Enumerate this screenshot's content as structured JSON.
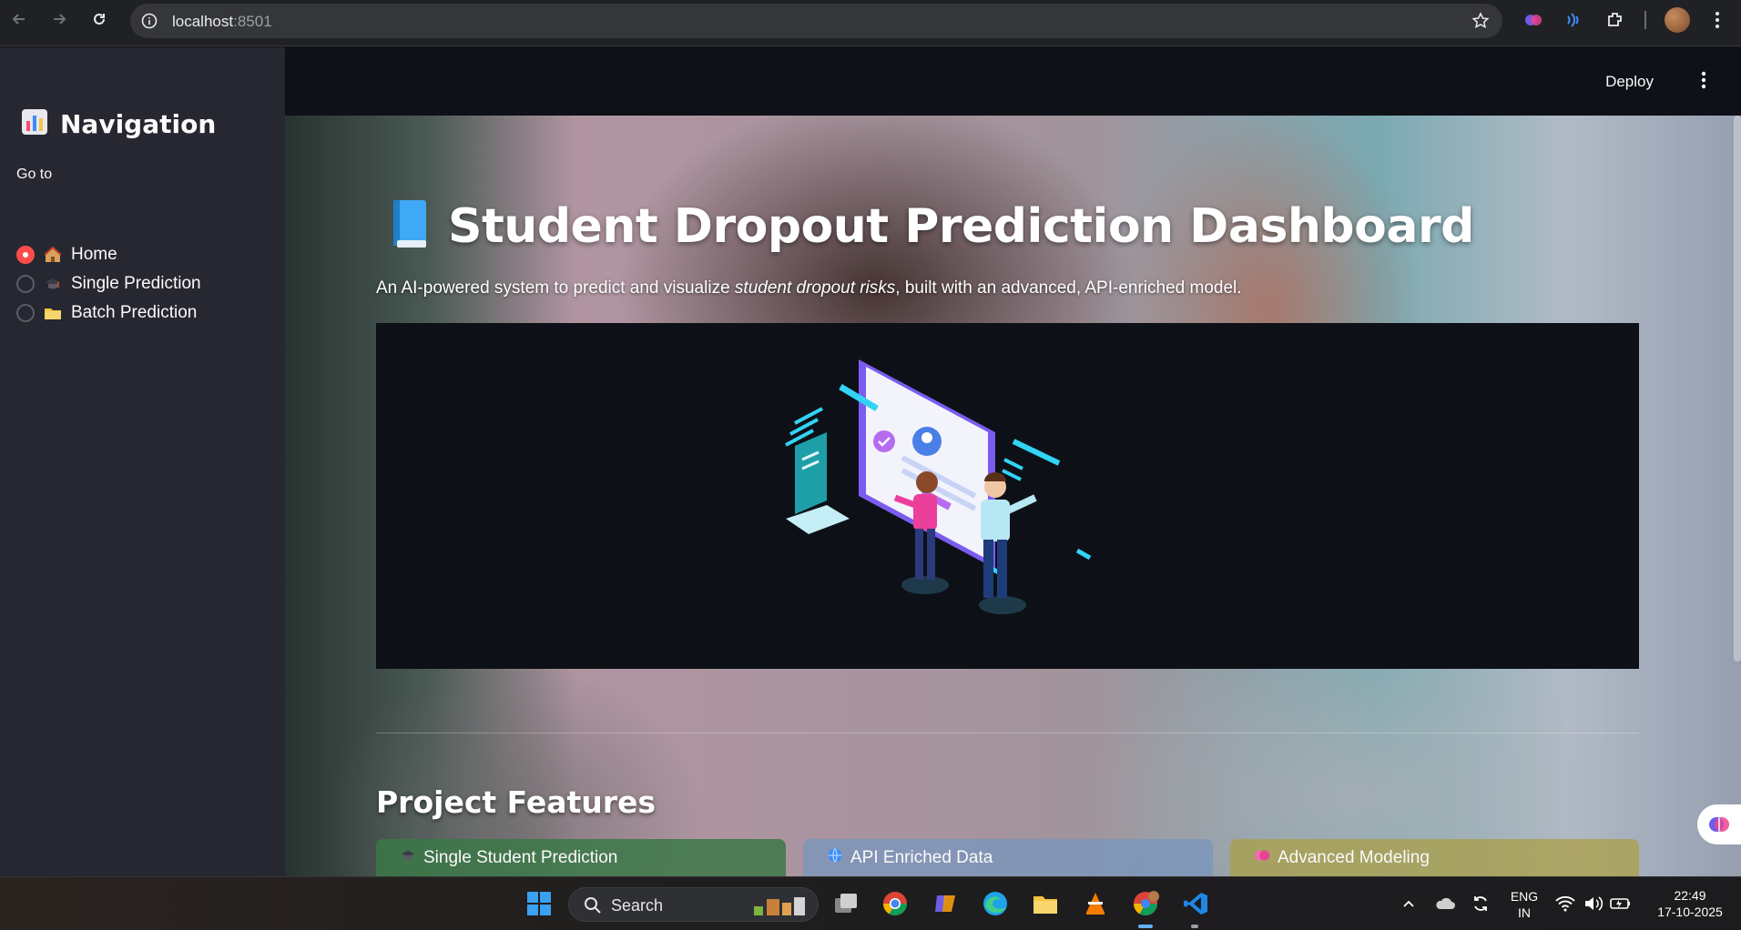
{
  "browser": {
    "url_host": "localhost",
    "url_port": ":8501"
  },
  "sidebar": {
    "title": "Navigation",
    "title_icon": "bar-chart-icon",
    "goto_label": "Go to",
    "options": [
      {
        "label": "Home",
        "icon": "house-icon",
        "selected": true
      },
      {
        "label": "Single Prediction",
        "icon": "graduation-cap-icon",
        "selected": false
      },
      {
        "label": "Batch Prediction",
        "icon": "folder-icon",
        "selected": false
      }
    ]
  },
  "header": {
    "deploy_label": "Deploy"
  },
  "main": {
    "title": "Student Dropout Prediction Dashboard",
    "title_icon": "blue-book-icon",
    "subtitle_pre": "An AI-powered system to predict and visualize ",
    "subtitle_em": "student dropout risks",
    "subtitle_post": ", built with an advanced, API-enriched model.",
    "features_title": "Project Features",
    "feature_cards": [
      {
        "label": "Single Student Prediction",
        "icon": "graduation-cap-icon"
      },
      {
        "label": "API Enriched Data",
        "icon": "globe-icon"
      },
      {
        "label": "Advanced Modeling",
        "icon": "brain-icon"
      }
    ]
  },
  "taskbar": {
    "search_label": "Search",
    "lang_primary": "ENG",
    "lang_secondary": "IN",
    "time": "22:49",
    "date": "17-10-2025"
  },
  "colors": {
    "accent": "#ff4b4b",
    "sidebar_bg": "#262730",
    "app_bg": "#0e1117"
  }
}
